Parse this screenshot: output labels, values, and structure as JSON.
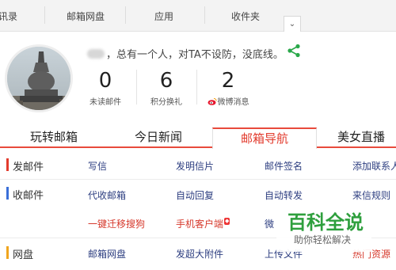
{
  "top_nav": {
    "items": [
      "讯录",
      "邮箱网盘",
      "应用",
      "收件夹"
    ],
    "dropdown_glyph": "⌄"
  },
  "profile": {
    "tagline": "，总有一个人，对TA不设防，没底线。",
    "stats": [
      {
        "value": "0",
        "label": "未读邮件"
      },
      {
        "value": "6",
        "label": "积分换礼"
      },
      {
        "value": "2",
        "label": "微博消息"
      }
    ]
  },
  "tabs": [
    "玩转邮箱",
    "今日新闻",
    "邮箱导航",
    "美女直播"
  ],
  "active_tab_index": 2,
  "sections": {
    "send": {
      "title": "发邮件",
      "color": "#e23b2d",
      "links": [
        "写信",
        "发明信片",
        "邮件签名",
        "添加联系人"
      ]
    },
    "receive": {
      "title": "收邮件",
      "color": "#3a6fd8",
      "links": [
        "代收邮箱",
        "自动回复",
        "自动转发",
        "来信规则"
      ],
      "links_row2": [
        "一键迁移搜狗",
        "手机客户端",
        "微"
      ]
    },
    "disk": {
      "title": "网盘",
      "color": "#f0a51e",
      "links": [
        "邮箱网盘",
        "发超大附件",
        "上传文件",
        "热门资源"
      ]
    }
  },
  "watermark": {
    "logo_text": "百科全说",
    "subtitle": "助你轻松解决"
  },
  "colors": {
    "accent_red": "#e84a3c",
    "link_blue": "#2d3e80",
    "watermark_green": "#2e9f3d"
  }
}
